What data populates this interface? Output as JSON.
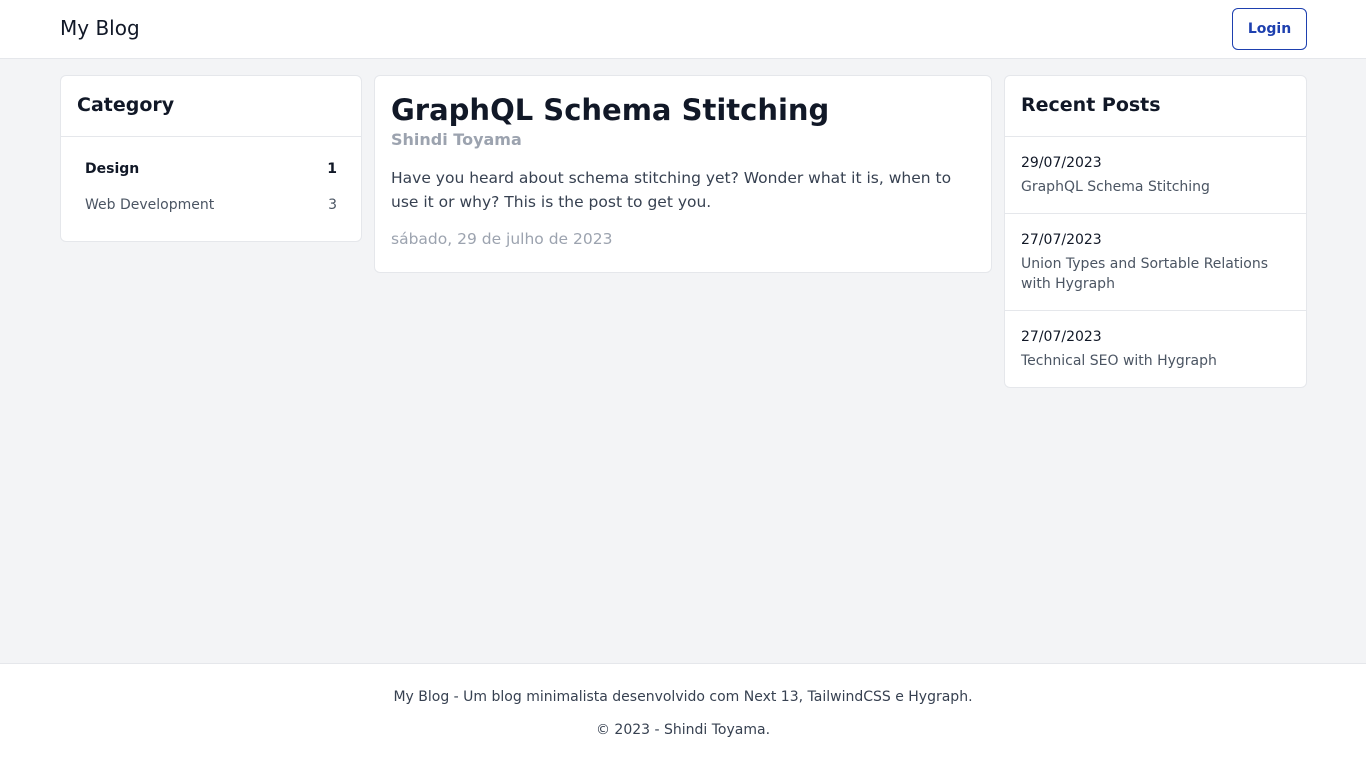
{
  "header": {
    "brand": "My Blog",
    "login_label": "Login"
  },
  "category": {
    "title": "Category",
    "items": [
      {
        "label": "Design",
        "count": "1",
        "active": true
      },
      {
        "label": "Web Development",
        "count": "3",
        "active": false
      }
    ]
  },
  "post": {
    "title": "GraphQL Schema Stitching",
    "author": "Shindi Toyama",
    "excerpt": "Have you heard about schema stitching yet? Wonder what it is, when to use it or why? This is the post to get you.",
    "date": "sábado, 29 de julho de 2023"
  },
  "recent": {
    "title": "Recent Posts",
    "items": [
      {
        "date": "29/07/2023",
        "title": "GraphQL Schema Stitching"
      },
      {
        "date": "27/07/2023",
        "title": "Union Types and Sortable Relations with Hygraph"
      },
      {
        "date": "27/07/2023",
        "title": "Technical SEO with Hygraph"
      }
    ]
  },
  "footer": {
    "line1": "My Blog - Um blog minimalista desenvolvido com Next 13, TailwindCSS e Hygraph.",
    "line2": "© 2023 - Shindi Toyama."
  }
}
